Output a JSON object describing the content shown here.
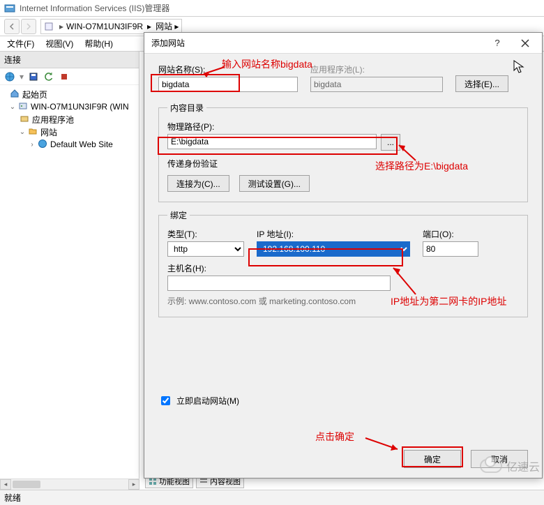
{
  "window": {
    "title": "Internet Information Services (IIS)管理器",
    "server_name": "WIN-O7M1UN3IF9R",
    "breadcrumb_sep": "▸",
    "breadcrumb_tail": "网站 ▸"
  },
  "menus": {
    "file": "文件(F)",
    "view": "视图(V)",
    "help": "帮助(H)"
  },
  "conn": {
    "header": "连接",
    "start_page": "起始页",
    "server_node": "WIN-O7M1UN3IF9R (WIN",
    "app_pools": "应用程序池",
    "sites": "网站",
    "default_site": "Default Web Site"
  },
  "status": {
    "ready": "就绪"
  },
  "tabs": {
    "features": "功能视图",
    "content": "内容视图"
  },
  "dialog": {
    "title": "添加网站",
    "site_name_label": "网站名称(S):",
    "site_name_value": "bigdata",
    "app_pool_label": "应用程序池(L):",
    "app_pool_value": "bigdata",
    "select_button": "选择(E)...",
    "content_group": "内容目录",
    "phys_path_label": "物理路径(P):",
    "phys_path_value": "E:\\bigdata",
    "browse_button": "...",
    "passthru_label": "传递身份验证",
    "connect_as": "连接为(C)...",
    "test_settings": "测试设置(G)...",
    "binding_group": "绑定",
    "type_label": "类型(T):",
    "type_value": "http",
    "ip_label": "IP 地址(I):",
    "ip_value": "192.168.100.110",
    "port_label": "端口(O):",
    "port_value": "80",
    "hostname_label": "主机名(H):",
    "hostname_value": "",
    "example": "示例: www.contoso.com 或 marketing.contoso.com",
    "start_immediately": "立即启动网站(M)",
    "ok": "确定",
    "cancel": "取消"
  },
  "annotations": {
    "a1": "输入网站名称bigdata",
    "a2": "选择路径为E:\\bigdata",
    "a3": "IP地址为第二网卡的IP地址",
    "a4": "点击确定"
  },
  "watermark": "亿速云"
}
